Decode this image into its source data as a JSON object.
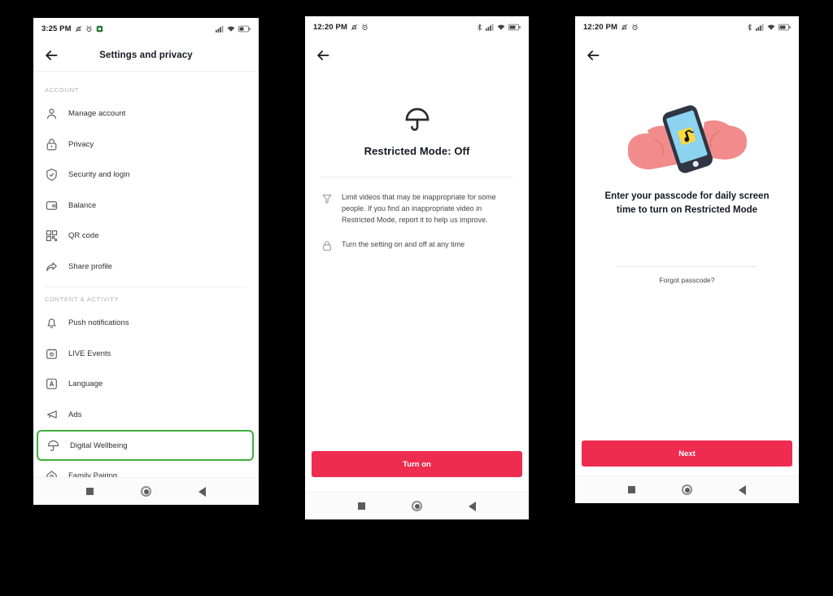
{
  "theme": {
    "background": "#000000",
    "panel_bg": "#ffffff",
    "accent_red": "#ED2C50",
    "highlight_green": "#3FAF3F",
    "text_primary": "#161823",
    "text_secondary": "#45454b",
    "muted": "#b0b0b4"
  },
  "panel_settings": {
    "status_bar": {
      "time": "3:25 PM",
      "left_icons": [
        "alarm-silent-icon",
        "alarm-clock-icon",
        "app-badge-icon"
      ],
      "right_icons": [
        "cellular-signal-icon",
        "wifi-icon",
        "battery-icon"
      ]
    },
    "header": {
      "title": "Settings and privacy",
      "back_icon": "back-arrow-icon"
    },
    "sections": [
      {
        "label": "ACCOUNT",
        "items": [
          {
            "label": "Manage account",
            "icon": "person-icon"
          },
          {
            "label": "Privacy",
            "icon": "lock-icon"
          },
          {
            "label": "Security and login",
            "icon": "shield-check-icon"
          },
          {
            "label": "Balance",
            "icon": "wallet-icon"
          },
          {
            "label": "QR code",
            "icon": "qr-code-icon"
          },
          {
            "label": "Share profile",
            "icon": "share-arrow-icon"
          }
        ]
      },
      {
        "label": "CONTENT & ACTIVITY",
        "items": [
          {
            "label": "Push notifications",
            "icon": "bell-icon"
          },
          {
            "label": "LIVE Events",
            "icon": "live-calendar-icon"
          },
          {
            "label": "Language",
            "icon": "language-a-icon"
          },
          {
            "label": "Ads",
            "icon": "megaphone-icon"
          },
          {
            "label": "Digital Wellbeing",
            "icon": "umbrella-icon",
            "highlighted": true
          },
          {
            "label": "Family Pairing",
            "icon": "home-gear-icon"
          }
        ]
      }
    ],
    "nav_bar": {
      "recents": "recents-square-icon",
      "home": "home-circle-icon",
      "back": "back-triangle-icon"
    }
  },
  "panel_restricted": {
    "status_bar": {
      "time": "12:20 PM",
      "left_icons": [
        "alarm-silent-icon",
        "alarm-clock-icon"
      ],
      "right_icons": [
        "bluetooth-icon",
        "cellular-signal-icon",
        "wifi-icon",
        "battery-icon"
      ]
    },
    "header": {
      "back_icon": "back-arrow-icon"
    },
    "hero_icon": "umbrella-icon",
    "title": "Restricted Mode: Off",
    "points": [
      {
        "icon": "filter-funnel-icon",
        "text": "Limit videos that may be inappropriate for some people. If you find an inappropriate video in Restricted Mode, report it to help us improve."
      },
      {
        "icon": "lock-icon",
        "text": "Turn the setting on and off at any time"
      }
    ],
    "cta_label": "Turn on",
    "nav_bar": {
      "recents": "recents-square-icon",
      "home": "home-circle-icon",
      "back": "back-triangle-icon"
    }
  },
  "panel_passcode": {
    "status_bar": {
      "time": "12:20 PM",
      "left_icons": [
        "alarm-silent-icon",
        "alarm-clock-icon"
      ],
      "right_icons": [
        "bluetooth-icon",
        "cellular-signal-icon",
        "wifi-icon",
        "battery-icon"
      ]
    },
    "header": {
      "back_icon": "back-arrow-icon"
    },
    "illustration": "hands-holding-phone-illustration",
    "title": "Enter your passcode for daily screen time to turn on Restricted Mode",
    "passcode_input": {
      "value": "",
      "placeholder": ""
    },
    "forgot_label": "Forgot passcode?",
    "cta_label": "Next",
    "nav_bar": {
      "recents": "recents-square-icon",
      "home": "home-circle-icon",
      "back": "back-triangle-icon"
    }
  }
}
